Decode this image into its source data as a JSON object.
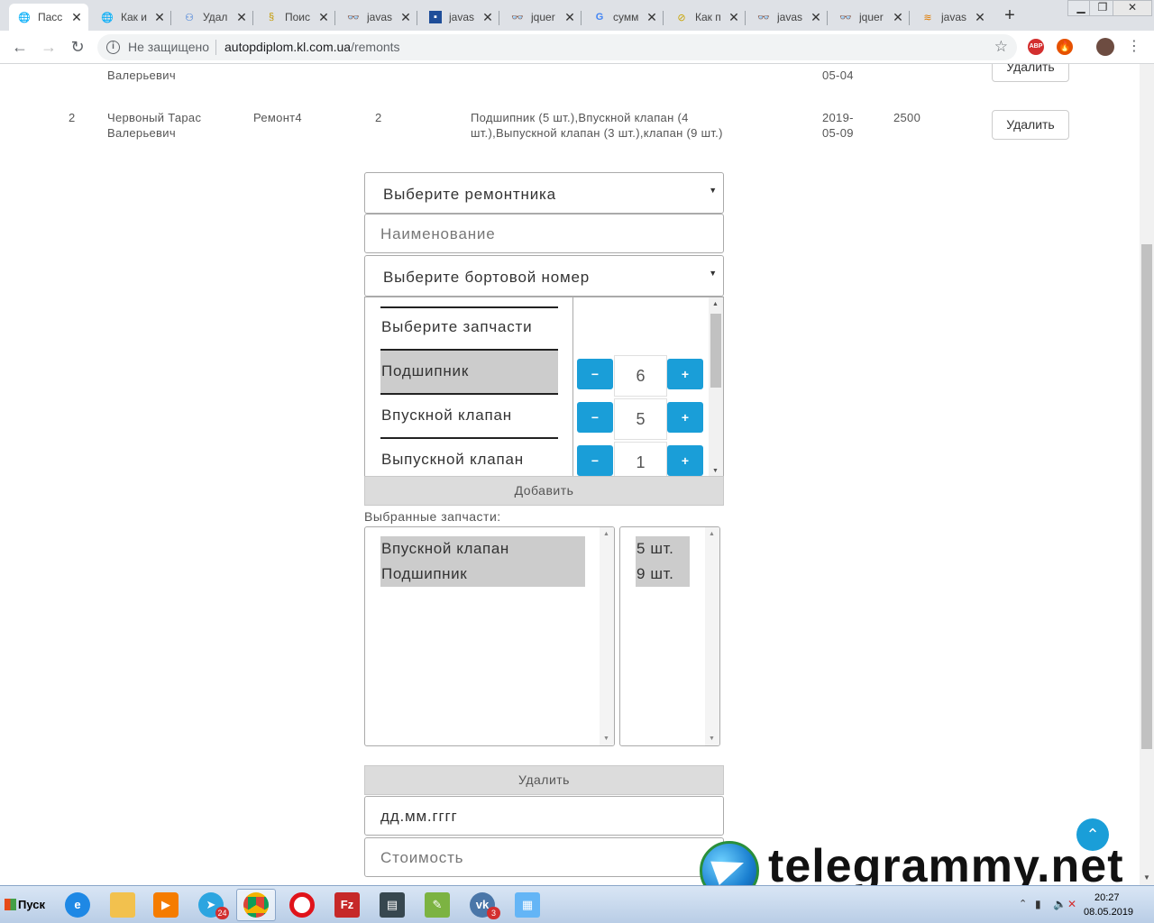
{
  "browser": {
    "tabs": [
      {
        "label": "Пасс",
        "icon": "globe-icon",
        "active": true
      },
      {
        "label": "Как и",
        "icon": "globe-icon"
      },
      {
        "label": "Удал",
        "icon": "bubbles-icon"
      },
      {
        "label": "Поис",
        "icon": "search-swirl-icon"
      },
      {
        "label": "javas",
        "icon": "sunglasses-icon"
      },
      {
        "label": "javas",
        "icon": "bookmark-icon"
      },
      {
        "label": "jquer",
        "icon": "sunglasses-icon"
      },
      {
        "label": "сумм",
        "icon": "google-icon"
      },
      {
        "label": "Как п",
        "icon": "compass-icon"
      },
      {
        "label": "javas",
        "icon": "sunglasses-icon"
      },
      {
        "label": "jquer",
        "icon": "sunglasses-icon"
      },
      {
        "label": "javas",
        "icon": "stack-icon"
      }
    ],
    "address": {
      "security_text": "Не защищено",
      "host": "autopdiplom.kl.com.ua",
      "path": "/remonts"
    },
    "extensions": {
      "adblock": "ABP"
    }
  },
  "table": {
    "row_partial": {
      "repairman_line2": "Валерьевич",
      "date_line2": "05-04",
      "delete_label": "Удалить"
    },
    "row": {
      "num": "2",
      "repairman": "Червоный Тарас Валерьевич",
      "name": "Ремонт4",
      "board": "2",
      "parts": "Подшипник (5 шт.),Впускной клапан (4 шт.),Выпускной клапан (3 шт.),клапан (9 шт.)",
      "date": "2019-05-09",
      "cost": "2500",
      "delete_label": "Удалить"
    }
  },
  "form": {
    "repairman_select": "Выберите ремонтника",
    "name_placeholder": "Наименование",
    "board_select": "Выберите бортовой номер",
    "parts_list": [
      {
        "label": "Выберите запчасти",
        "selected": false
      },
      {
        "label": "Подшипник",
        "selected": true,
        "qty": "6"
      },
      {
        "label": "Впускной клапан",
        "selected": false,
        "qty": "5"
      },
      {
        "label": "Выпускной клапан",
        "selected": false,
        "qty": "1"
      }
    ],
    "minus_symbol": "−",
    "plus_symbol": "+",
    "add_label": "Добавить",
    "selected_parts_label": "Выбранные запчасти:",
    "selected_parts": [
      "Впускной клапан",
      "Подшипник"
    ],
    "selected_quantities": [
      "5 шт.",
      "9 шт."
    ],
    "remove_label": "Удалить",
    "date_placeholder": "дд.мм.гггг",
    "cost_placeholder": "Стоимость"
  },
  "watermark": {
    "text": "telegrammy.net"
  },
  "taskbar": {
    "start_label": "Пуск",
    "apps": [
      {
        "icon": "internet-explorer-icon"
      },
      {
        "icon": "file-explorer-icon"
      },
      {
        "icon": "media-player-icon"
      },
      {
        "icon": "telegram-icon",
        "badge": "24"
      },
      {
        "icon": "chrome-icon",
        "active": true
      },
      {
        "icon": "opera-icon"
      },
      {
        "icon": "filezilla-icon"
      },
      {
        "icon": "terminal-icon"
      },
      {
        "icon": "notepadpp-icon"
      },
      {
        "icon": "vk-icon",
        "badge": "3"
      },
      {
        "icon": "control-panel-icon"
      }
    ],
    "clock_time": "20:27",
    "clock_date": "08.05.2019"
  },
  "colors": {
    "accent": "#1a9ed8",
    "selected_bg": "#cccccc",
    "button_gray": "#dcdcdc"
  }
}
